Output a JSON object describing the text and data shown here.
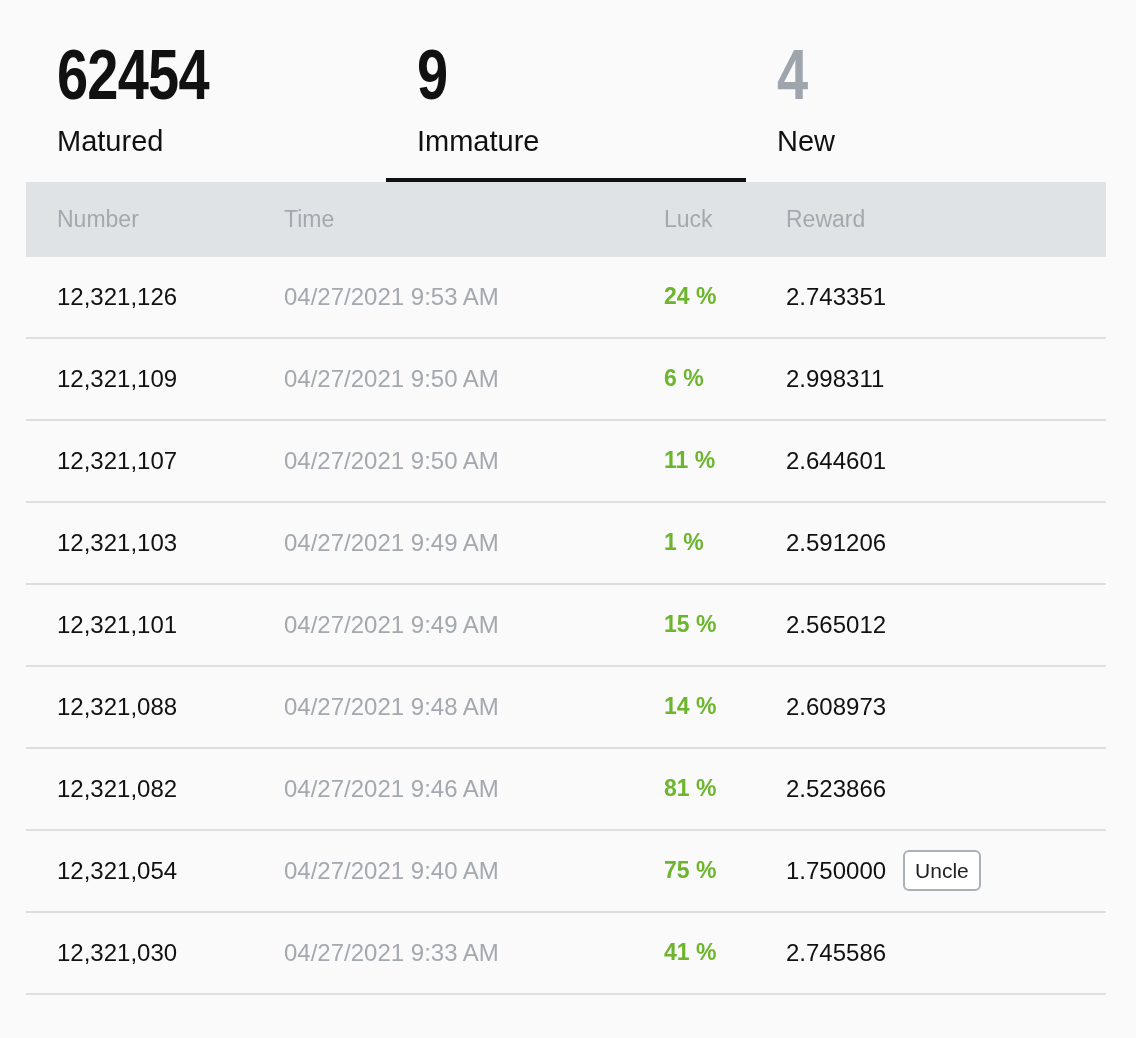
{
  "tabs": [
    {
      "count": "62454",
      "label": "Matured",
      "selected": false,
      "muted": false
    },
    {
      "count": "9",
      "label": "Immature",
      "selected": true,
      "muted": false
    },
    {
      "count": "4",
      "label": "New",
      "selected": false,
      "muted": true
    }
  ],
  "table": {
    "columns": [
      "Number",
      "Time",
      "Luck",
      "Reward"
    ],
    "rows": [
      {
        "number": "12,321,126",
        "time": "04/27/2021 9:53 AM",
        "luck": "24 %",
        "reward": "2.743351"
      },
      {
        "number": "12,321,109",
        "time": "04/27/2021 9:50 AM",
        "luck": "6 %",
        "reward": "2.998311"
      },
      {
        "number": "12,321,107",
        "time": "04/27/2021 9:50 AM",
        "luck": "11 %",
        "reward": "2.644601"
      },
      {
        "number": "12,321,103",
        "time": "04/27/2021 9:49 AM",
        "luck": "1 %",
        "reward": "2.591206"
      },
      {
        "number": "12,321,101",
        "time": "04/27/2021 9:49 AM",
        "luck": "15 %",
        "reward": "2.565012"
      },
      {
        "number": "12,321,088",
        "time": "04/27/2021 9:48 AM",
        "luck": "14 %",
        "reward": "2.608973"
      },
      {
        "number": "12,321,082",
        "time": "04/27/2021 9:46 AM",
        "luck": "81 %",
        "reward": "2.523866"
      },
      {
        "number": "12,321,054",
        "time": "04/27/2021 9:40 AM",
        "luck": "75 %",
        "reward": "1.750000",
        "tag": "Uncle"
      },
      {
        "number": "12,321,030",
        "time": "04/27/2021 9:33 AM",
        "luck": "41 %",
        "reward": "2.745586"
      }
    ]
  }
}
